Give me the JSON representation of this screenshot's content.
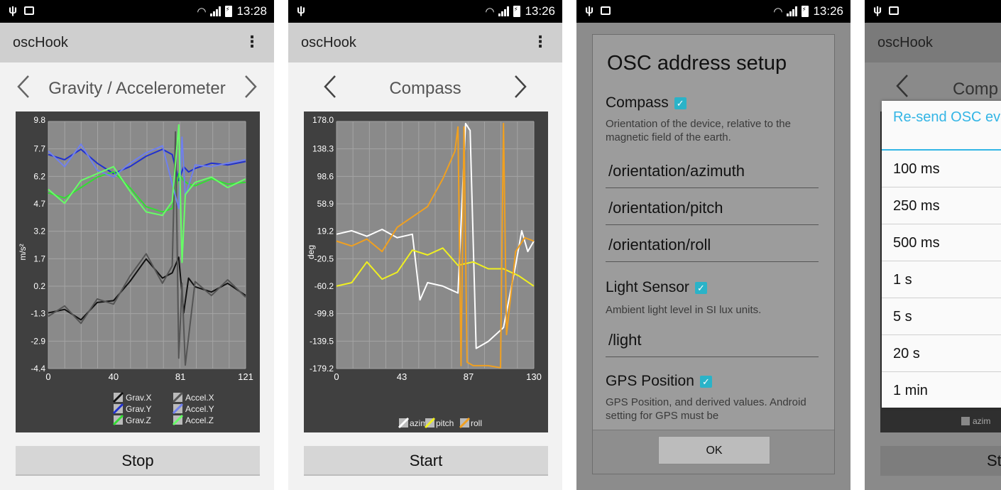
{
  "status": {
    "p1_time": "13:28",
    "p2_time": "13:26",
    "p3_time": "13:26"
  },
  "app": {
    "title": "oscHook",
    "menu_icon": "overflow-menu-icon"
  },
  "screen1": {
    "nav_title": "Gravity / Accelerometer",
    "button": "Stop",
    "chart_title_top": "9.8",
    "ylabel": "m/s²",
    "yticks": [
      "7.7",
      "6.2",
      "4.7",
      "3.2",
      "1.7",
      "0.2",
      "-1.3",
      "-2.9",
      "-4.4"
    ],
    "xticks": [
      "0",
      "40",
      "81",
      "121"
    ],
    "legend": [
      "Grav.X",
      "Accel.X",
      "Grav.Y",
      "Accel.Y",
      "Grav.Z",
      "Accel.Z"
    ]
  },
  "screen2": {
    "nav_title": "Compass",
    "button": "Start",
    "chart_title_top": "178.0",
    "ylabel": "deg",
    "yticks": [
      "138.3",
      "98.6",
      "58.9",
      "19.2",
      "-20.5",
      "-60.2",
      "-99.8",
      "-139.5",
      "-179.2"
    ],
    "xticks": [
      "0",
      "43",
      "87",
      "130"
    ],
    "legend": [
      "azimu",
      "pitch",
      "roll"
    ]
  },
  "screen3": {
    "dialog_title": "OSC address setup",
    "compass_label": "Compass",
    "compass_desc": "Orientation of the device, relative to the magnetic field of the earth.",
    "fields_compass": [
      "/orientation/azimuth",
      "/orientation/pitch",
      "/orientation/roll"
    ],
    "light_label": "Light Sensor",
    "light_desc": "Ambient light level in SI lux units.",
    "light_field": "/light",
    "gps_label": "GPS Position",
    "gps_desc": "GPS Position, and derived values. Android setting for GPS must be",
    "ok": "OK"
  },
  "screen4": {
    "app_title": "oscHook",
    "nav_title_partial": "Comp",
    "popup_title": "Re-send OSC every",
    "options": [
      "100 ms",
      "250 ms",
      "500 ms",
      "1 s",
      "5 s",
      "20 s",
      "1 min"
    ],
    "legend_partial": "azim",
    "button_partial": "Sta"
  },
  "chart_data": [
    {
      "type": "line",
      "title": "",
      "xlabel": "",
      "ylabel": "m/s²",
      "xlim": [
        0,
        121
      ],
      "ylim": [
        -4.4,
        9.8
      ],
      "series": [
        {
          "name": "Grav.X",
          "color": "#111111",
          "x": [
            0,
            10,
            20,
            30,
            40,
            50,
            60,
            70,
            76,
            80,
            83,
            86,
            90,
            100,
            110,
            121
          ],
          "y": [
            -1.2,
            -1.0,
            -1.6,
            -0.6,
            -0.5,
            0.6,
            1.9,
            0.8,
            1.1,
            2.0,
            -1.2,
            0.8,
            0.3,
            0.0,
            0.5,
            -0.2
          ]
        },
        {
          "name": "Grav.Y",
          "color": "#2030d0",
          "x": [
            0,
            10,
            20,
            30,
            40,
            50,
            60,
            70,
            76,
            80,
            83,
            86,
            90,
            100,
            110,
            121
          ],
          "y": [
            7.9,
            7.6,
            8.2,
            7.4,
            6.8,
            7.2,
            7.8,
            8.2,
            7.9,
            6.4,
            7.2,
            6.9,
            7.1,
            7.4,
            7.3,
            7.5
          ]
        },
        {
          "name": "Grav.Z",
          "color": "#33dd33",
          "x": [
            0,
            10,
            20,
            30,
            40,
            50,
            60,
            70,
            76,
            80,
            83,
            86,
            90,
            100,
            110,
            121
          ],
          "y": [
            5.7,
            5.4,
            6.0,
            6.6,
            6.9,
            6.0,
            4.9,
            4.6,
            4.8,
            6.8,
            6.4,
            6.2,
            6.1,
            6.5,
            6.2,
            6.3
          ]
        },
        {
          "name": "Accel.X",
          "color": "#555555",
          "x": [
            0,
            10,
            20,
            30,
            40,
            50,
            60,
            70,
            76,
            78,
            80,
            82,
            84,
            90,
            100,
            110,
            121
          ],
          "y": [
            -1.4,
            -0.8,
            -1.8,
            -0.4,
            -0.7,
            0.9,
            2.2,
            0.5,
            1.5,
            9.2,
            -3.8,
            0.5,
            -4.2,
            0.6,
            -0.2,
            0.7,
            -0.3
          ]
        },
        {
          "name": "Accel.Y",
          "color": "#7080ee",
          "x": [
            0,
            10,
            20,
            30,
            40,
            50,
            60,
            70,
            76,
            80,
            82,
            84,
            90,
            100,
            110,
            121
          ],
          "y": [
            8.1,
            7.2,
            8.5,
            7.0,
            6.6,
            7.4,
            8.0,
            8.4,
            6.2,
            4.8,
            8.9,
            5.5,
            7.3,
            7.2,
            7.4,
            7.6
          ]
        },
        {
          "name": "Accel.Z",
          "color": "#66ff66",
          "x": [
            0,
            10,
            20,
            30,
            40,
            50,
            60,
            70,
            76,
            80,
            82,
            84,
            90,
            100,
            110,
            121
          ],
          "y": [
            5.9,
            5.1,
            6.4,
            6.8,
            7.2,
            5.8,
            4.6,
            4.4,
            5.2,
            9.6,
            1.7,
            5.6,
            6.3,
            6.6,
            6.0,
            6.5
          ]
        }
      ]
    },
    {
      "type": "line",
      "title": "",
      "xlabel": "",
      "ylabel": "deg",
      "xlim": [
        0,
        130
      ],
      "ylim": [
        -179.2,
        178.0
      ],
      "series": [
        {
          "name": "azimu",
          "color": "#ffffff",
          "x": [
            0,
            10,
            20,
            30,
            40,
            50,
            55,
            60,
            70,
            80,
            85,
            88,
            92,
            100,
            110,
            118,
            122,
            126,
            130
          ],
          "y": [
            15,
            20,
            12,
            22,
            10,
            15,
            -80,
            -55,
            -60,
            -70,
            175,
            165,
            -150,
            -140,
            -120,
            -30,
            20,
            -10,
            5
          ]
        },
        {
          "name": "pitch",
          "color": "#f0f020",
          "x": [
            0,
            10,
            20,
            30,
            40,
            50,
            60,
            70,
            80,
            90,
            100,
            110,
            120,
            130
          ],
          "y": [
            -60,
            -55,
            -25,
            -50,
            -40,
            -8,
            -15,
            -5,
            -30,
            -25,
            -35,
            -35,
            -45,
            -60
          ]
        },
        {
          "name": "roll",
          "color": "#f0a020",
          "x": [
            0,
            10,
            20,
            30,
            40,
            50,
            60,
            70,
            78,
            80,
            82,
            84,
            86,
            90,
            100,
            108,
            110,
            112,
            118,
            124,
            130
          ],
          "y": [
            5,
            -2,
            8,
            -10,
            25,
            40,
            55,
            95,
            135,
            170,
            -175,
            170,
            -170,
            -175,
            -175,
            -178,
            175,
            -130,
            -10,
            10,
            5
          ]
        }
      ]
    }
  ]
}
